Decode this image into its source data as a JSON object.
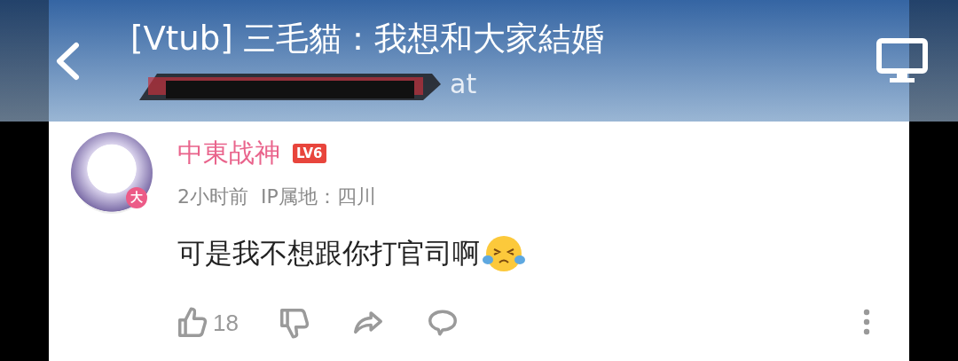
{
  "header": {
    "title": "[Vtub] 三毛貓：我想和大家結婚",
    "subtitle_visible": "at"
  },
  "comment": {
    "author": "中東战神",
    "level_badge": "LV6",
    "avatar_badge": "大",
    "meta": "2小时前  IP属地：四川",
    "text": "可是我不想跟你打官司啊",
    "actions": [
      {
        "kind": "like",
        "count": "18"
      },
      {
        "kind": "dislike"
      },
      {
        "kind": "share"
      },
      {
        "kind": "reply"
      }
    ]
  }
}
